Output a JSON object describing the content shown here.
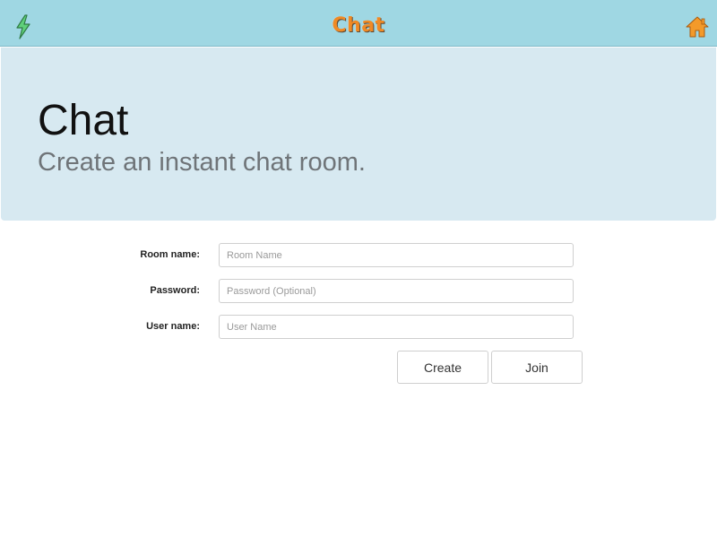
{
  "header": {
    "title": "Chat",
    "left_icon": "lightning-bolt-icon",
    "home_icon": "home-icon",
    "title_color": "#f08a24",
    "bar_color": "#9fd7e3"
  },
  "hero": {
    "heading": "Chat",
    "subtitle": "Create an instant chat room.",
    "background": "#d7e9f1"
  },
  "form": {
    "room_name": {
      "label": "Room name:",
      "placeholder": "Room Name",
      "value": ""
    },
    "password": {
      "label": "Password:",
      "placeholder": "Password (Optional)",
      "value": ""
    },
    "user_name": {
      "label": "User name:",
      "placeholder": "User Name",
      "value": ""
    },
    "create_label": "Create",
    "join_label": "Join"
  }
}
